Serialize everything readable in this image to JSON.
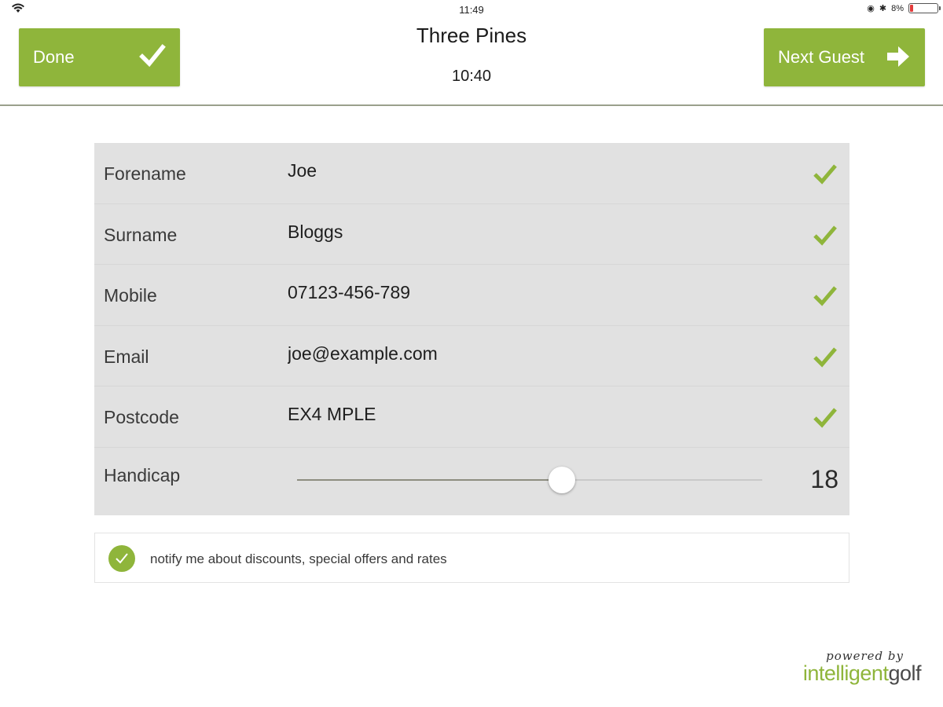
{
  "status_bar": {
    "time": "11:49",
    "battery_text": "8%"
  },
  "header": {
    "done_label": "Done",
    "next_label": "Next Guest",
    "title": "Three Pines",
    "tee_time": "10:40"
  },
  "form": {
    "fields": [
      {
        "label": "Forename",
        "value": "Joe"
      },
      {
        "label": "Surname",
        "value": "Bloggs"
      },
      {
        "label": "Mobile",
        "value": "07123-456-789"
      },
      {
        "label": "Email",
        "value": "joe@example.com"
      },
      {
        "label": "Postcode",
        "value": "EX4 MPLE"
      }
    ],
    "handicap": {
      "label": "Handicap",
      "value": "18",
      "slider_fraction": 0.57
    }
  },
  "notify": {
    "text": "notify me about discounts, special offers and rates",
    "checked": true
  },
  "branding": {
    "powered_by": "powered by",
    "logo_part1": "intelligent",
    "logo_part2": "golf"
  },
  "colors": {
    "accent": "#8fb53b",
    "form_bg": "#e1e1e1",
    "text": "#222222"
  },
  "icons": {
    "done": "check-icon",
    "next": "arrow-right-icon",
    "field_valid": "check-icon",
    "status_wifi": "wifi-icon",
    "status_battery": "battery-icon"
  }
}
